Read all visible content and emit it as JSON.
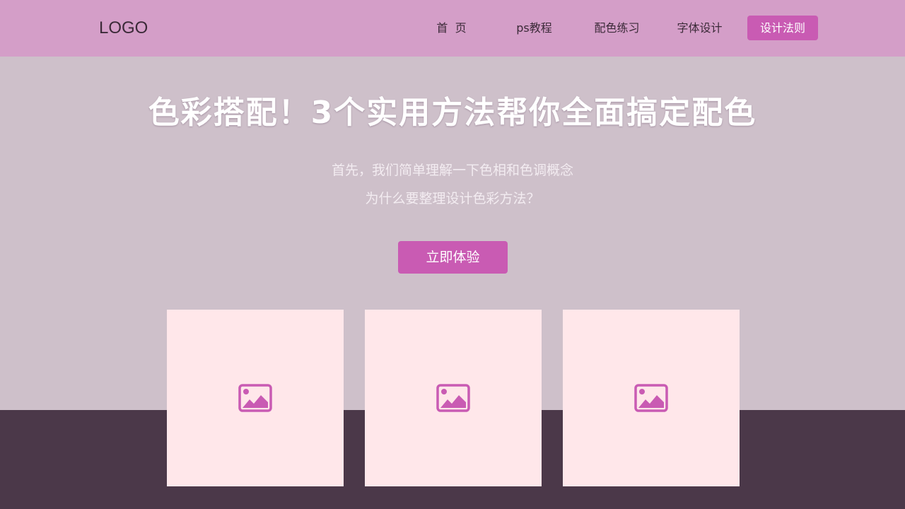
{
  "header": {
    "logo": "LOGO",
    "nav": [
      {
        "label": "首  页"
      },
      {
        "label": "ps教程"
      },
      {
        "label": "配色练习"
      },
      {
        "label": "字体设计"
      },
      {
        "label": "设计法则",
        "active": true
      }
    ]
  },
  "hero": {
    "title": "色彩搭配！3个实用方法帮你全面搞定配色",
    "subtitle_line1": "首先，我们简单理解一下色相和色调概念",
    "subtitle_line2": "为什么要整理设计色彩方法？",
    "cta_label": "立即体验"
  },
  "cards": [
    {
      "icon": "image-placeholder-icon"
    },
    {
      "icon": "image-placeholder-icon"
    },
    {
      "icon": "image-placeholder-icon"
    }
  ],
  "colors": {
    "header_bg": "#d49ec8",
    "page_bg": "#cec0ca",
    "bottom_band": "#4b3849",
    "accent": "#c95bb3",
    "card_bg": "#ffe7ea"
  }
}
